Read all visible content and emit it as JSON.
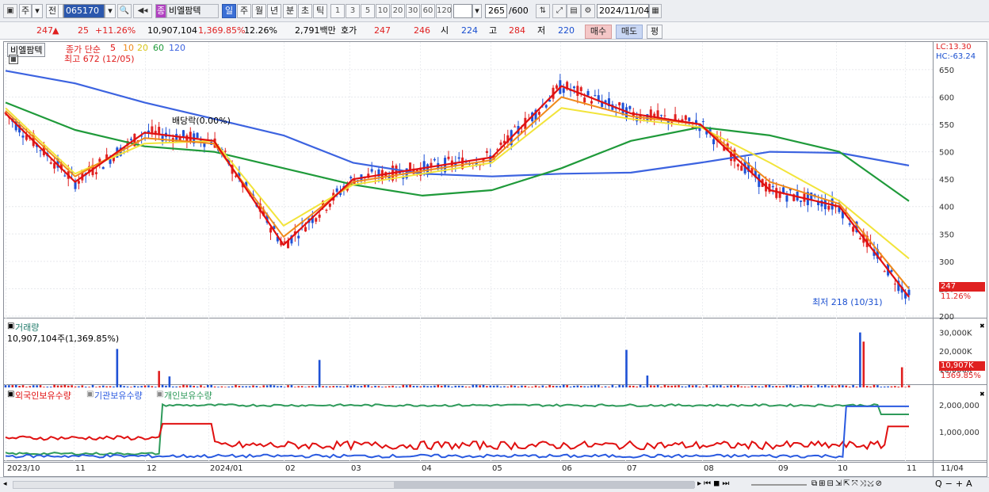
{
  "toolbar": {
    "market": "주",
    "market2": "전",
    "code": "065170",
    "badge": "종",
    "name": "비엘팜텍",
    "periods": [
      "일",
      "주",
      "월",
      "년",
      "분",
      "초",
      "틱"
    ],
    "intervals": [
      "1",
      "3",
      "5",
      "10",
      "20",
      "30",
      "60",
      "120"
    ],
    "count": "265",
    "count_total": "/600",
    "date": "2024/11/04"
  },
  "quote": {
    "price": "247",
    "arrow": "▲",
    "change": "25",
    "change_pct": "+11.26%",
    "volume": "10,907,104",
    "volume_pct": "1,369.85%",
    "turnover": "12.26%",
    "amount": "2,791백만",
    "ask_label": "호가",
    "ask": "247",
    "bid": "246",
    "open_label": "시",
    "open": "224",
    "high_label": "고",
    "high": "284",
    "low_label": "저",
    "low": "220",
    "buy": "매수",
    "sell": "매도",
    "eval": "평"
  },
  "price_pane": {
    "stock_tag": "비엘팜텍",
    "ma_title": "종가 단순",
    "ma_periods": [
      "5",
      "10",
      "20",
      "60",
      "120"
    ],
    "high_note": "최고 672 (12/05)",
    "low_note": "최저 218 (10/31)",
    "dividend_note": "배당락(0.00%)",
    "lc": "LC:13.30",
    "hc": "HC:-63.24",
    "last_price": "247",
    "last_pct": "11.26%",
    "y_ticks": [
      "650",
      "600",
      "550",
      "500",
      "450",
      "400",
      "350",
      "300",
      "250",
      "200"
    ]
  },
  "volume_pane": {
    "title": "거래량",
    "value": "10,907,104주(1,369.85%)",
    "last": "10,907K",
    "last_pct": "1369.85%",
    "y_ticks": [
      "30,000K",
      "20,000K",
      "10,000K"
    ]
  },
  "holdings_pane": {
    "series": [
      "외국인보유수량",
      "기관보유수량",
      "개인보유수량"
    ],
    "y_ticks": [
      "2,000,000",
      "1,000,000"
    ]
  },
  "x_axis": [
    "2023/10",
    "11",
    "12",
    "2024/01",
    "02",
    "03",
    "04",
    "05",
    "06",
    "07",
    "08",
    "09",
    "10",
    "11",
    "11/04"
  ],
  "colors": {
    "up": "#e02020",
    "down": "#1f52d6",
    "ma5": "#e01010",
    "ma10": "#f08a1a",
    "ma20": "#f2e43a",
    "ma60": "#1f9a3a",
    "ma120": "#3c63e0",
    "foreign": "#e01010",
    "institution": "#2a5ae0",
    "individual": "#2e9a5a"
  },
  "chart_data": {
    "type": "line",
    "title": "비엘팜텍 일봉",
    "x": [
      "2023/10",
      "11",
      "12",
      "2024/01",
      "02",
      "03",
      "04",
      "05",
      "06",
      "07",
      "08",
      "09",
      "10",
      "11"
    ],
    "series": [
      {
        "name": "5",
        "values": [
          570,
          445,
          535,
          520,
          330,
          450,
          470,
          490,
          620,
          570,
          550,
          430,
          400,
          235
        ]
      },
      {
        "name": "10",
        "values": [
          575,
          455,
          525,
          515,
          345,
          445,
          465,
          485,
          600,
          565,
          550,
          445,
          405,
          250
        ]
      },
      {
        "name": "20",
        "values": [
          580,
          460,
          515,
          520,
          365,
          440,
          460,
          480,
          580,
          560,
          545,
          480,
          410,
          305
        ]
      },
      {
        "name": "60",
        "values": [
          590,
          540,
          510,
          500,
          470,
          440,
          420,
          430,
          470,
          520,
          545,
          530,
          500,
          410
        ]
      },
      {
        "name": "120",
        "values": [
          648,
          625,
          590,
          560,
          530,
          480,
          460,
          455,
          460,
          462,
          480,
          500,
          498,
          475
        ]
      }
    ],
    "ylim": [
      200,
      660
    ]
  }
}
